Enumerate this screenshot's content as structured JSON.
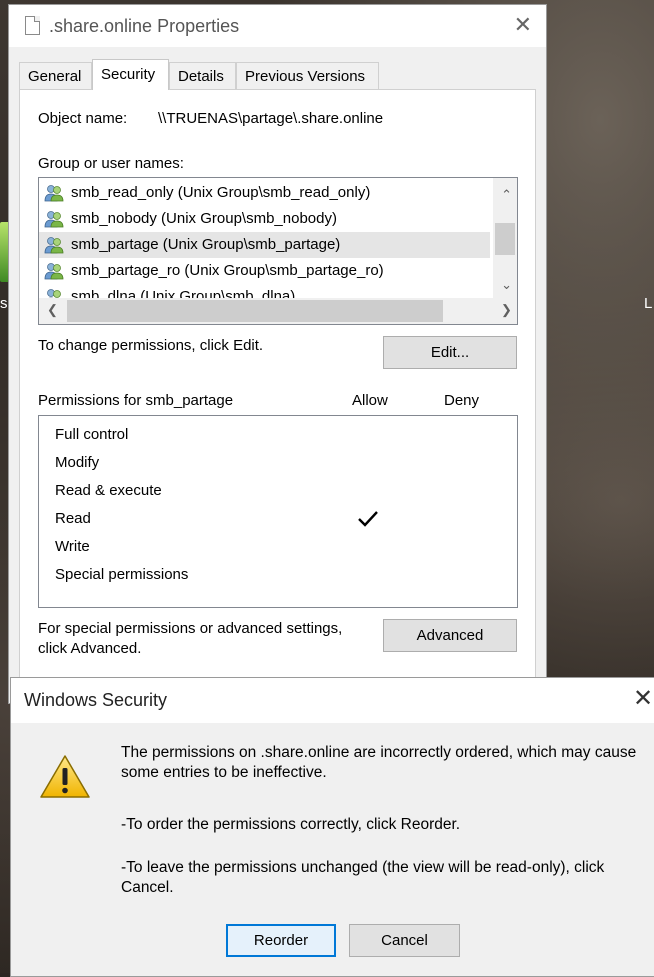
{
  "desktop": {
    "left_label": "si",
    "right_label": "L"
  },
  "properties": {
    "title": ".share.online Properties",
    "close_glyph": "✕",
    "tabs": [
      {
        "label": "General"
      },
      {
        "label": "Security"
      },
      {
        "label": "Details"
      },
      {
        "label": "Previous Versions"
      }
    ],
    "object_name_label": "Object name:",
    "object_name_value": "\\\\TRUENAS\\partage\\.share.online",
    "groups_label": "Group or user names:",
    "groups": [
      {
        "name": "smb_read_only (Unix Group\\smb_read_only)"
      },
      {
        "name": "smb_nobody (Unix Group\\smb_nobody)"
      },
      {
        "name": "smb_partage (Unix Group\\smb_partage)"
      },
      {
        "name": "smb_partage_ro (Unix Group\\smb_partage_ro)"
      },
      {
        "name": "smb_dlna (Unix Group\\smb_dlna)"
      }
    ],
    "change_perm_text": "To change permissions, click Edit.",
    "edit_button": "Edit...",
    "permissions_for": "Permissions for smb_partage",
    "allow_header": "Allow",
    "deny_header": "Deny",
    "permissions": [
      {
        "name": "Full control",
        "allow": false,
        "deny": false
      },
      {
        "name": "Modify",
        "allow": false,
        "deny": false
      },
      {
        "name": "Read & execute",
        "allow": false,
        "deny": false
      },
      {
        "name": "Read",
        "allow": true,
        "deny": false
      },
      {
        "name": "Write",
        "allow": false,
        "deny": false
      },
      {
        "name": "Special permissions",
        "allow": false,
        "deny": false
      }
    ],
    "special_text_line1": "For special permissions or advanced settings,",
    "special_text_line2": "click Advanced.",
    "advanced_button": "Advanced"
  },
  "security_dialog": {
    "title": "Windows Security",
    "close_glyph": "✕",
    "message_line1": "The permissions on .share.online are incorrectly ordered, which may cause",
    "message_line2": "some entries to be ineffective.",
    "reorder_hint": "-To order the permissions correctly, click Reorder.",
    "cancel_hint_line1": "-To leave the permissions unchanged (the view will be read-only), click",
    "cancel_hint_line2": "Cancel.",
    "reorder_button": "Reorder",
    "cancel_button": "Cancel",
    "icon": "warning-icon",
    "accent_color": "#0078d7"
  }
}
